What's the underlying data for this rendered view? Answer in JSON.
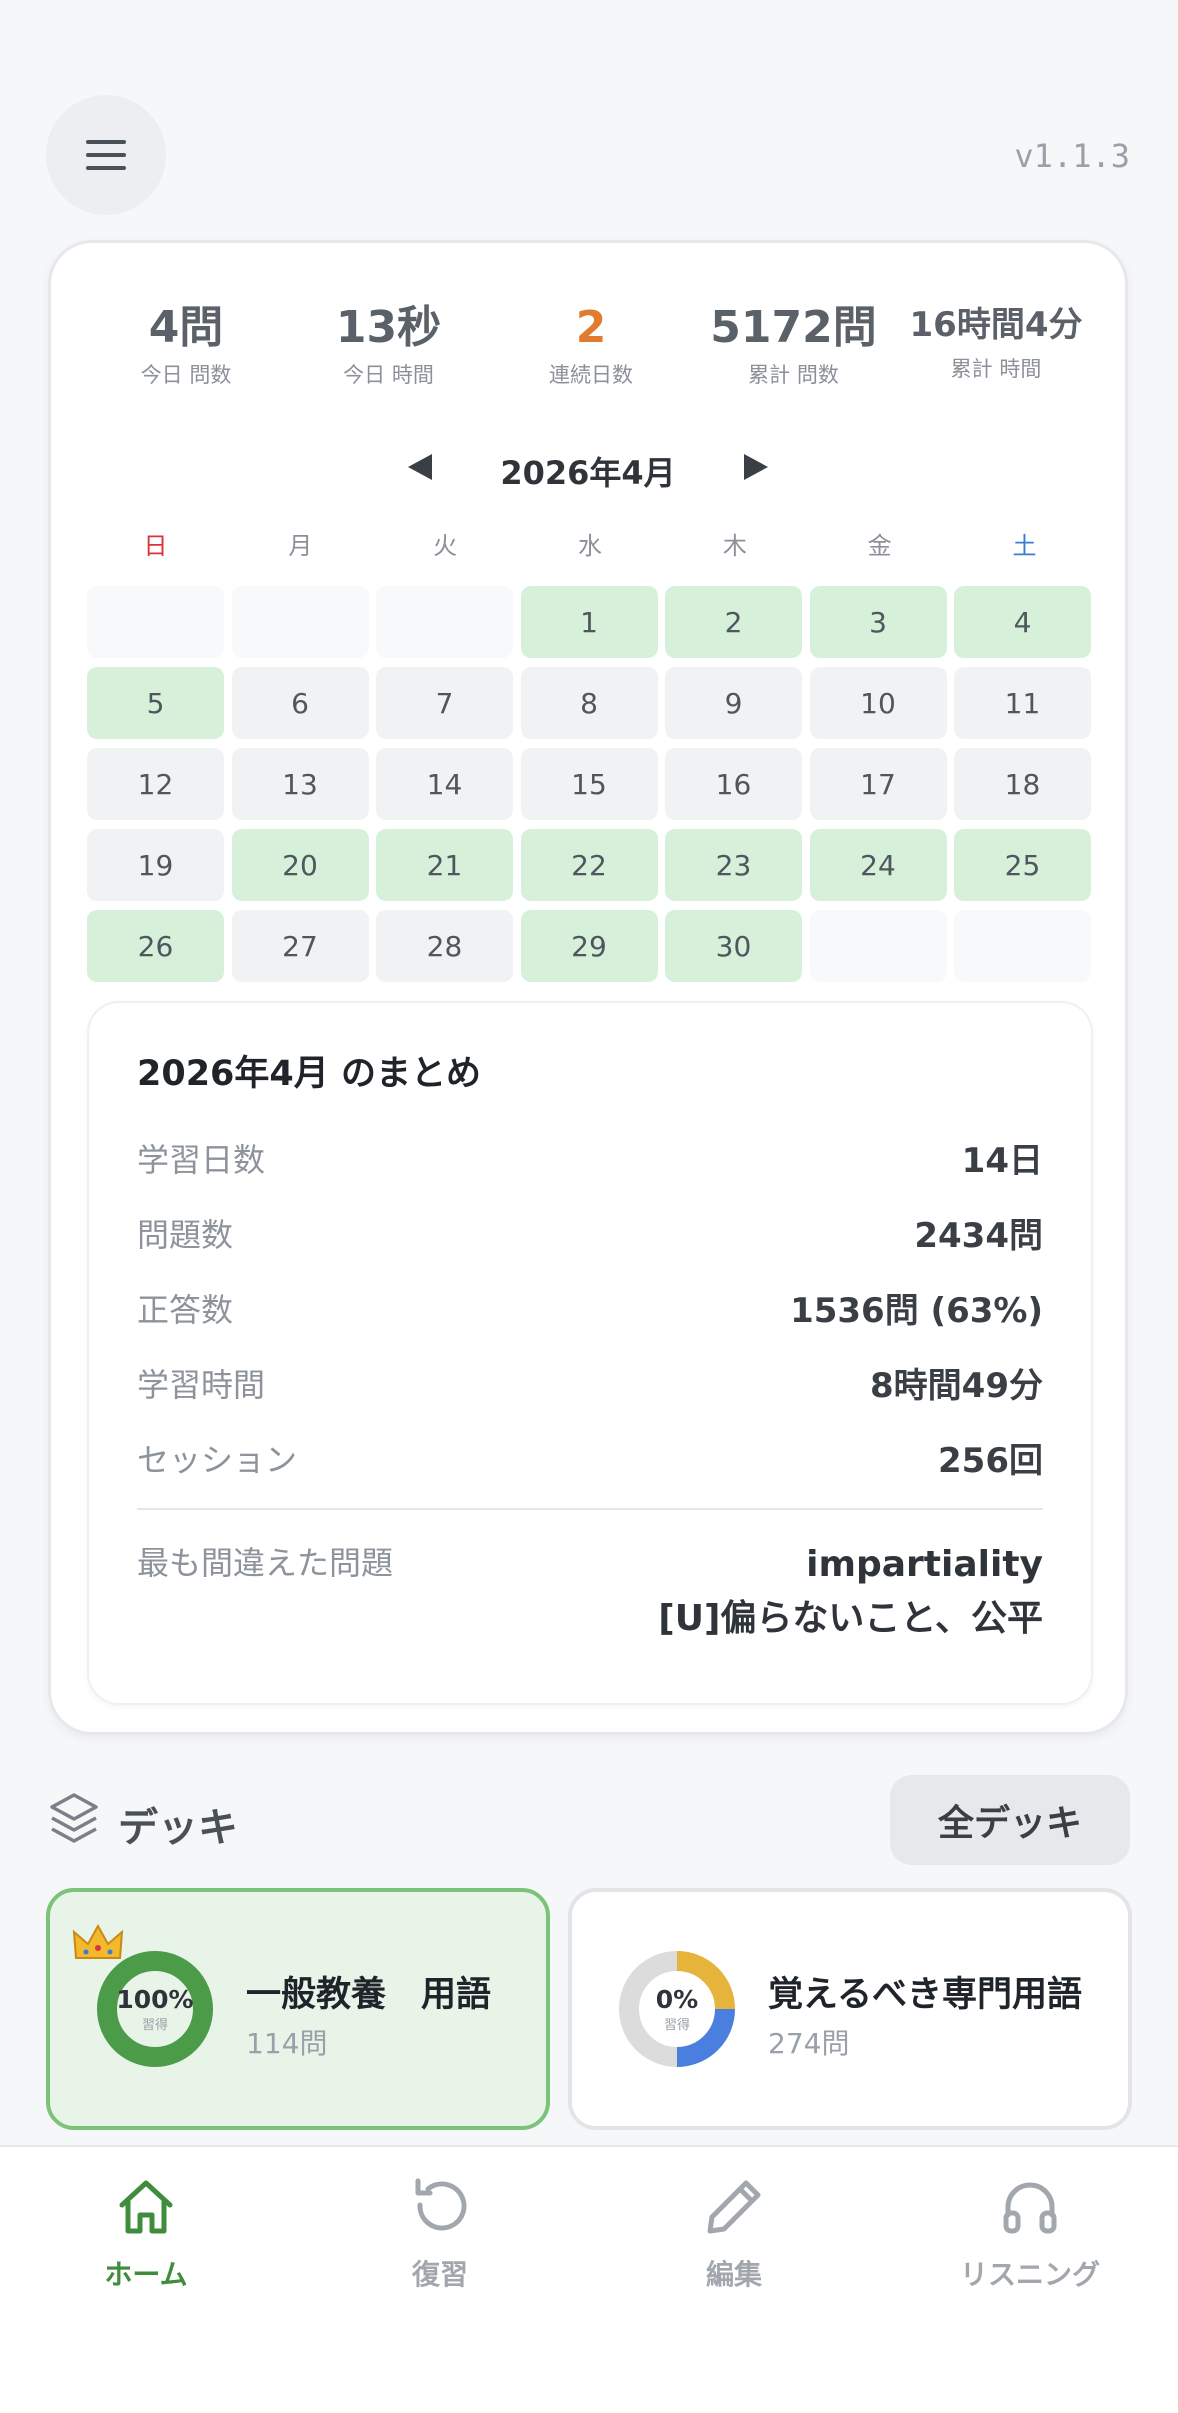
{
  "header": {
    "menu_icon": "menu-icon",
    "version": "v1.1.3"
  },
  "stats": [
    {
      "value": "4問",
      "label": "今日 問数"
    },
    {
      "value": "13秒",
      "label": "今日 時間"
    },
    {
      "value": "2",
      "label": "連続日数"
    },
    {
      "value": "5172問",
      "label": "累計 問数"
    },
    {
      "value": "16時間4分",
      "label": "累計 時間"
    }
  ],
  "calendar": {
    "month_title": "2026年4月",
    "prev_icon": "triangle-left-icon",
    "next_icon": "triangle-right-icon",
    "weekdays": [
      "日",
      "月",
      "火",
      "水",
      "木",
      "金",
      "土"
    ],
    "days": [
      "",
      "",
      "",
      "1",
      "2",
      "3",
      "4",
      "5",
      "6",
      "7",
      "8",
      "9",
      "10",
      "11",
      "12",
      "13",
      "14",
      "15",
      "16",
      "17",
      "18",
      "19",
      "20",
      "21",
      "22",
      "23",
      "24",
      "25",
      "26",
      "27",
      "28",
      "29",
      "30",
      "",
      ""
    ],
    "studied": [
      1,
      2,
      3,
      4,
      5,
      20,
      21,
      22,
      23,
      24,
      25,
      26,
      29,
      30
    ]
  },
  "summary": {
    "title": "2026年4月 のまとめ",
    "rows": [
      {
        "label": "学習日数",
        "value": "14日"
      },
      {
        "label": "問題数",
        "value": "2434問"
      },
      {
        "label": "正答数",
        "value": "1536問 (63%)"
      },
      {
        "label": "学習時間",
        "value": "8時間49分"
      },
      {
        "label": "セッション",
        "value": "256回"
      }
    ],
    "worst_label": "最も間違えた問題",
    "worst_word": "impartiality",
    "worst_meaning": "[U]偏らないこと、公平"
  },
  "decks": {
    "section_title": "デッキ",
    "all_button": "全デッキ",
    "items": [
      {
        "name": "一般教養　用語",
        "count": "114問",
        "percent": "100%",
        "mastered_label": "習得",
        "progress": 1.0,
        "active": true
      },
      {
        "name": "覚えるべき専門用語",
        "count": "274問",
        "percent": "0%",
        "mastered_label": "習得",
        "progress": 0.0,
        "active": false
      }
    ]
  },
  "tabs": [
    {
      "label": "ホーム",
      "icon": "home-icon",
      "active": true
    },
    {
      "label": "復習",
      "icon": "refresh-icon",
      "active": false
    },
    {
      "label": "編集",
      "icon": "pencil-icon",
      "active": false
    },
    {
      "label": "リスニング",
      "icon": "headphones-icon",
      "active": false
    }
  ],
  "colors": {
    "accent": "#3f8c3c",
    "studied": "#d6f0da",
    "streak": "#e07b30",
    "sunday": "#d8343a",
    "saturday": "#3e7bd6"
  }
}
